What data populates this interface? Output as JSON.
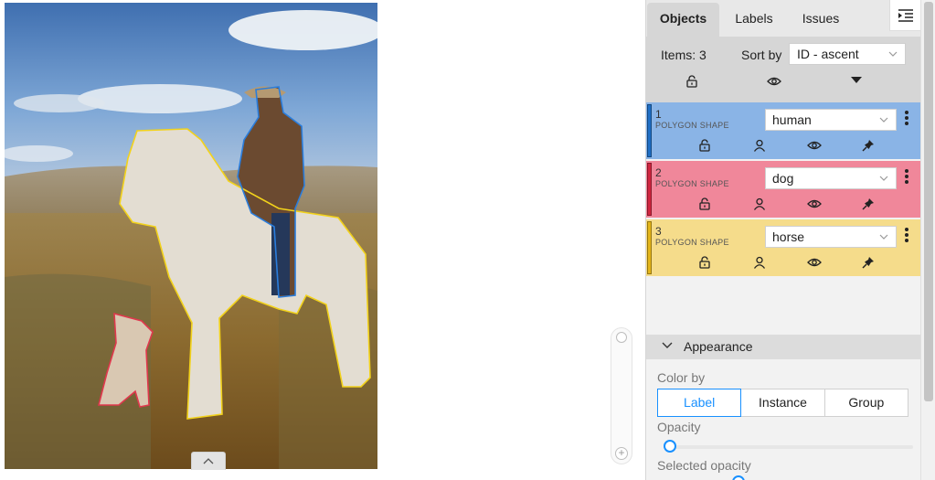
{
  "tabs": {
    "objects": "Objects",
    "labels": "Labels",
    "issues": "Issues"
  },
  "objects_header": {
    "items_count": "Items: 3",
    "sort_label": "Sort by",
    "sort_value": "ID - ascent"
  },
  "objects": [
    {
      "id": "1",
      "shape": "POLYGON SHAPE",
      "label": "human",
      "color": "#8ab4e6",
      "stripe": "#1f6fc5"
    },
    {
      "id": "2",
      "shape": "POLYGON SHAPE",
      "label": "dog",
      "color": "#f0879a",
      "stripe": "#d0263f"
    },
    {
      "id": "3",
      "shape": "POLYGON SHAPE",
      "label": "horse",
      "color": "#f5dc8b",
      "stripe": "#e4b51a"
    }
  ],
  "appearance": {
    "title": "Appearance",
    "color_by_label": "Color by",
    "color_by_options": [
      "Label",
      "Instance",
      "Group"
    ],
    "color_by_selected": "Label",
    "opacity_label": "Opacity",
    "opacity_value": 0,
    "selected_opacity_label": "Selected opacity"
  },
  "icons": {
    "lock": "unlock-icon",
    "user": "user-icon",
    "eye": "eye-icon",
    "pin": "pin-icon",
    "collapse": "collapse-sidebar-icon",
    "zoom_in": "zoom-in-icon",
    "chevron": "chevron-down-icon"
  }
}
